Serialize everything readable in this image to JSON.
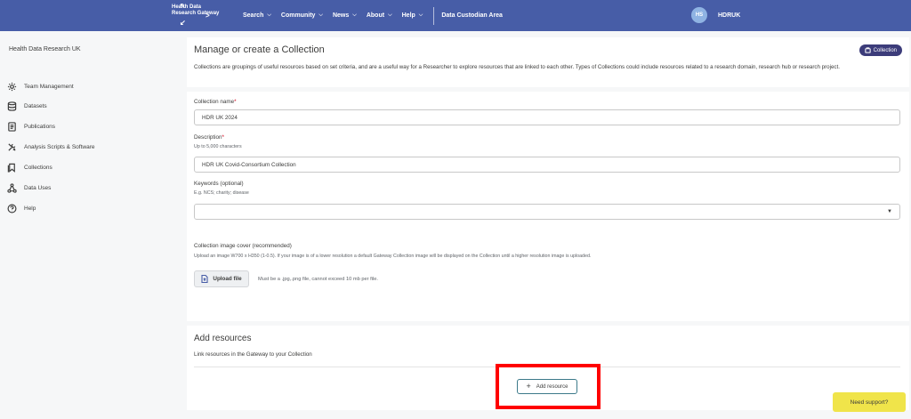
{
  "nav": {
    "logo_lines": [
      "Health Data",
      "Research Gateway"
    ],
    "items": [
      {
        "label": "Search"
      },
      {
        "label": "Community"
      },
      {
        "label": "News"
      },
      {
        "label": "About"
      },
      {
        "label": "Help"
      }
    ],
    "custodian_area": "Data Custodian Area",
    "user_initials": "HS",
    "user_name": "HDRUK"
  },
  "sidebar": {
    "org_name": "Health Data Research UK",
    "items": [
      {
        "label": "Team Management",
        "icon": "gear-icon"
      },
      {
        "label": "Datasets",
        "icon": "database-icon"
      },
      {
        "label": "Publications",
        "icon": "document-icon"
      },
      {
        "label": "Analysis Scripts & Software",
        "icon": "tools-icon"
      },
      {
        "label": "Collections",
        "icon": "bookmark-icon"
      },
      {
        "label": "Data Uses",
        "icon": "network-icon"
      },
      {
        "label": "Help",
        "icon": "question-icon"
      }
    ]
  },
  "header": {
    "title": "Manage or create a Collection",
    "badge": "Collection",
    "description": "Collections are groupings of useful resources based on set criteria, and are a useful way for a Researcher to explore resources that are linked to each other. Types of Collections could include resources related to a research domain, research hub or research project."
  },
  "form": {
    "collection_name_label": "Collection name",
    "collection_name_value": "HDR UK 2024",
    "description_label": "Description",
    "description_hint": "Up to 5,000 characters",
    "description_value": "HDR UK Covid-Consortium Collection",
    "keywords_label": "Keywords (optional)",
    "keywords_hint": "E.g. NCS; charity; disease",
    "keywords_value": "",
    "image_label": "Collection image cover (recommended)",
    "image_hint": "Upload an image W700 x H350 (1-0.5). If your image is of a lower resolution a default Gateway Collection image will be displayed on the Collection until a higher resolution image is uploaded.",
    "upload_label": "Upload file",
    "upload_note": "Must be a .jpg,.png file, cannot exceed 10 mb per file."
  },
  "resources": {
    "title": "Add resources",
    "description": "Link resources in the Gateway to your Collection",
    "add_label": "Add resource"
  },
  "support_label": "Need support?",
  "colors": {
    "nav_bg": "#475da7",
    "badge_bg": "#3c3c7a",
    "support_bg": "#f0e44a",
    "highlight": "#ff0000",
    "required": "#d0021b"
  }
}
